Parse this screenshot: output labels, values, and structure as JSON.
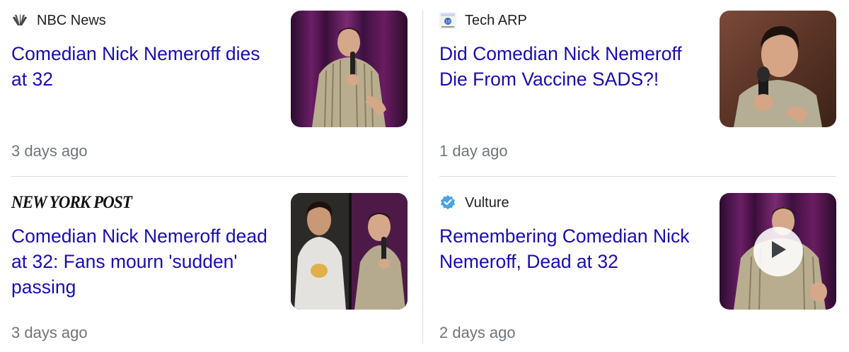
{
  "cards": [
    {
      "source": "NBC News",
      "source_logo": "nbc-peacock-logo",
      "headline": "Comedian Nick Nemeroff dies at 32",
      "time": "3 days ago",
      "thumbnail": "comedian-on-stage-photo"
    },
    {
      "source": "Tech ARP",
      "source_logo": "tech-arp-logo",
      "headline": "Did Comedian Nick Nemeroff Die From Vaccine SADS?!",
      "time": "1 day ago",
      "thumbnail": "comedian-closeup-photo"
    },
    {
      "source_logo_text": "NEW YORK POST",
      "source_logo": "new-york-post-logo",
      "headline": "Comedian Nick Nemeroff dead at 32: Fans mourn 'sudden' passing",
      "time": "3 days ago",
      "thumbnail": "comedian-split-photo"
    },
    {
      "source": "Vulture",
      "source_logo": "verified-badge-icon",
      "headline": "Remembering Comedian Nick Nemeroff, Dead at 32",
      "time": "2 days ago",
      "thumbnail": "comedian-video-thumbnail",
      "thumbnail_badge": "play-icon"
    }
  ],
  "colors": {
    "headline_link": "#1a0dab",
    "source_text": "#202124",
    "timestamp": "#70757a",
    "divider": "#dadce0"
  }
}
